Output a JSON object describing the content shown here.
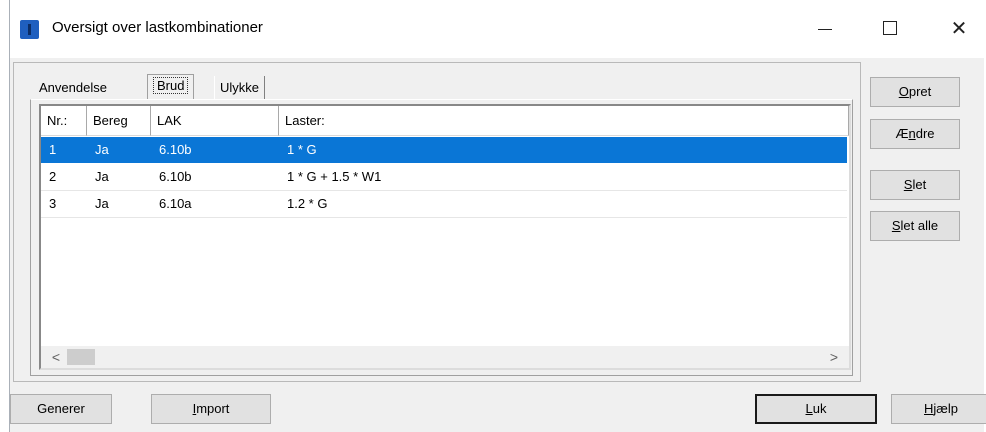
{
  "window": {
    "title": "Oversigt over lastkombinationer",
    "controls": {
      "minimize": "—",
      "maximize": "☐",
      "close": "✕"
    }
  },
  "tabs": [
    {
      "label": "Anvendelse",
      "active": false
    },
    {
      "label": "Brud",
      "active": true
    },
    {
      "label": "Ulykke",
      "active": false
    }
  ],
  "table": {
    "columns": [
      "Nr.:",
      "Bereg",
      "LAK",
      "Laster:"
    ],
    "rows": [
      {
        "nr": "1",
        "bereg": "Ja",
        "lak": "6.10b",
        "laster": "1 * G",
        "selected": true
      },
      {
        "nr": "2",
        "bereg": "Ja",
        "lak": "6.10b",
        "laster": "1 * G + 1.5 * W1",
        "selected": false
      },
      {
        "nr": "3",
        "bereg": "Ja",
        "lak": "6.10a",
        "laster": "1.2 * G",
        "selected": false
      }
    ],
    "scroll_left": "<",
    "scroll_right": ">"
  },
  "side_buttons": {
    "opret": {
      "mnemonic": "O",
      "rest": "pret"
    },
    "aendre": {
      "pre": "Æ",
      "mnemonic": "n",
      "rest": "dre"
    },
    "slet": {
      "mnemonic": "S",
      "rest": "let"
    },
    "slet_alle": {
      "mnemonic": "S",
      "rest": "let alle"
    }
  },
  "bottom_buttons": {
    "generer": "Generer",
    "import": {
      "mnemonic": "I",
      "rest": "mport"
    },
    "luk": {
      "mnemonic": "L",
      "rest": "uk"
    },
    "hjaelp": {
      "mnemonic": "H",
      "rest": "jælp"
    }
  },
  "colors": {
    "selection": "#0a76d6",
    "window_bg": "#f0f0f0",
    "app_icon": "#1f5fbf"
  }
}
